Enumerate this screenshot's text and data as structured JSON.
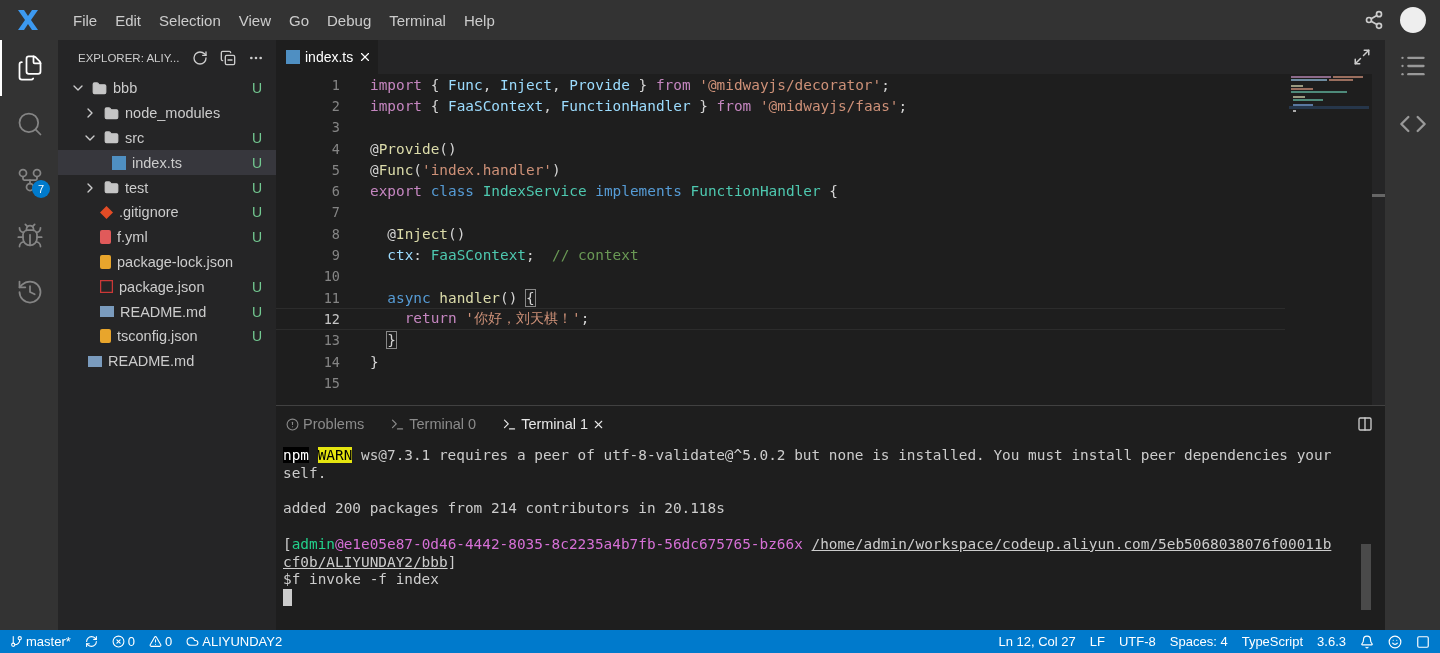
{
  "menu": [
    "File",
    "Edit",
    "Selection",
    "View",
    "Go",
    "Debug",
    "Terminal",
    "Help"
  ],
  "activity_bar": [
    {
      "kind": "files",
      "selected": true
    },
    {
      "kind": "search",
      "selected": false
    },
    {
      "kind": "source-control",
      "selected": false,
      "badge": "7"
    },
    {
      "kind": "debug",
      "selected": false
    },
    {
      "kind": "history",
      "selected": false
    }
  ],
  "explorer": {
    "title": "EXPLORER: ALIY...",
    "tree": [
      {
        "label": "bbb",
        "kind": "folder",
        "expanded": true,
        "selected": false,
        "badge": "U",
        "children": [
          {
            "label": "node_modules",
            "kind": "folder",
            "expanded": false,
            "selected": false
          },
          {
            "label": "src",
            "kind": "folder",
            "expanded": true,
            "selected": false,
            "badge": "U",
            "children": [
              {
                "label": "index.ts",
                "kind": "ts",
                "selected": true,
                "badge": "U"
              }
            ]
          },
          {
            "label": "test",
            "kind": "folder",
            "expanded": false,
            "selected": false,
            "badge": "U"
          },
          {
            "label": ".gitignore",
            "kind": "git",
            "selected": false,
            "badge": "U"
          },
          {
            "label": "f.yml",
            "kind": "yaml",
            "selected": false,
            "badge": "U"
          },
          {
            "label": "package-lock.json",
            "kind": "db",
            "selected": false
          },
          {
            "label": "package.json",
            "kind": "npm",
            "selected": false,
            "badge": "U"
          },
          {
            "label": "README.md",
            "kind": "markdown",
            "selected": false,
            "badge": "U"
          },
          {
            "label": "tsconfig.json",
            "kind": "db",
            "selected": false,
            "badge": "U"
          }
        ]
      },
      {
        "label": "README.md",
        "kind": "markdown",
        "selected": false
      }
    ]
  },
  "editor_tabs": [
    {
      "label": "index.ts",
      "selected": true
    }
  ],
  "code_lines": [
    {
      "number": "1",
      "current": false,
      "tokens": [
        {
          "text": "import",
          "kind": "keyword"
        },
        {
          "text": " { ",
          "kind": "plain"
        },
        {
          "text": "Func",
          "kind": "variable"
        },
        {
          "text": ", ",
          "kind": "plain"
        },
        {
          "text": "Inject",
          "kind": "variable"
        },
        {
          "text": ", ",
          "kind": "plain"
        },
        {
          "text": "Provide",
          "kind": "variable"
        },
        {
          "text": " } ",
          "kind": "plain"
        },
        {
          "text": "from",
          "kind": "keyword"
        },
        {
          "text": " '@midwayjs/decorator'",
          "kind": "string"
        },
        {
          "text": ";",
          "kind": "plain"
        }
      ]
    },
    {
      "number": "2",
      "current": false,
      "tokens": [
        {
          "text": "import",
          "kind": "keyword"
        },
        {
          "text": " { ",
          "kind": "plain"
        },
        {
          "text": "FaaSContext",
          "kind": "variable"
        },
        {
          "text": ", ",
          "kind": "plain"
        },
        {
          "text": "FunctionHandler",
          "kind": "variable"
        },
        {
          "text": " } ",
          "kind": "plain"
        },
        {
          "text": "from",
          "kind": "keyword"
        },
        {
          "text": " '@midwayjs/faas'",
          "kind": "string"
        },
        {
          "text": ";",
          "kind": "plain"
        }
      ]
    },
    {
      "number": "3",
      "current": false
    },
    {
      "number": "4",
      "current": false,
      "tokens": [
        {
          "text": "@",
          "kind": "plain"
        },
        {
          "text": "Provide",
          "kind": "function"
        },
        {
          "text": "()",
          "kind": "plain"
        }
      ]
    },
    {
      "number": "5",
      "current": false,
      "tokens": [
        {
          "text": "@",
          "kind": "plain"
        },
        {
          "text": "Func",
          "kind": "function"
        },
        {
          "text": "(",
          "kind": "plain"
        },
        {
          "text": "'index.handler'",
          "kind": "string"
        },
        {
          "text": ")",
          "kind": "plain"
        }
      ]
    },
    {
      "number": "6",
      "current": false,
      "tokens": [
        {
          "text": "export",
          "kind": "keyword"
        },
        {
          "text": " class",
          "kind": "storage"
        },
        {
          "text": " IndexService",
          "kind": "type"
        },
        {
          "text": " implements",
          "kind": "storage"
        },
        {
          "text": " FunctionHandler",
          "kind": "type"
        },
        {
          "text": " {",
          "kind": "plain"
        }
      ]
    },
    {
      "number": "7",
      "current": false
    },
    {
      "number": "8",
      "current": false,
      "tokens": [
        {
          "text": "  @",
          "kind": "plain"
        },
        {
          "text": "Inject",
          "kind": "function"
        },
        {
          "text": "()",
          "kind": "plain"
        }
      ]
    },
    {
      "number": "9",
      "current": false,
      "tokens": [
        {
          "text": "  ctx",
          "kind": "variable"
        },
        {
          "text": ": ",
          "kind": "plain"
        },
        {
          "text": "FaaSContext",
          "kind": "type"
        },
        {
          "text": ";  ",
          "kind": "plain"
        },
        {
          "text": "// context",
          "kind": "comment"
        }
      ]
    },
    {
      "number": "10",
      "current": false
    },
    {
      "number": "11",
      "current": false,
      "tokens": [
        {
          "text": "  async",
          "kind": "storage"
        },
        {
          "text": " handler",
          "kind": "function"
        },
        {
          "text": "() ",
          "kind": "plain"
        },
        {
          "text": "{",
          "kind": "bracket"
        }
      ]
    },
    {
      "number": "12",
      "current": true,
      "tokens": [
        {
          "text": "    return",
          "kind": "keyword"
        },
        {
          "text": " '你好，刘天棋！'",
          "kind": "string"
        },
        {
          "text": ";",
          "kind": "plain"
        }
      ]
    },
    {
      "number": "13",
      "current": false,
      "tokens": [
        {
          "text": "  }",
          "kind": "bracket"
        }
      ]
    },
    {
      "number": "14",
      "current": false,
      "tokens": [
        {
          "text": "}",
          "kind": "plain"
        }
      ]
    },
    {
      "number": "15",
      "current": false
    }
  ],
  "panel_tabs": [
    {
      "label": "Problems",
      "kind": "problems",
      "selected": false
    },
    {
      "label": "Terminal 0",
      "kind": "terminal",
      "selected": false
    },
    {
      "label": "Terminal 1",
      "kind": "terminal",
      "selected": true
    }
  ],
  "terminal_lines": [
    {
      "space_before": false,
      "tokens": [
        {
          "text": "npm",
          "kind": "inverse"
        },
        {
          "text": "WARN",
          "kind": "warn"
        },
        {
          "text": " ws@7.3.1 requires a peer of utf-8-validate@^5.0.2 but none is installed. You must install peer dependencies your",
          "kind": "plain"
        }
      ]
    },
    {
      "space_before": false,
      "tokens": [
        {
          "text": "self.",
          "kind": "plain"
        }
      ]
    },
    {
      "space_before": true,
      "tokens": [
        {
          "text": "added 200 packages from 214 contributors in 20.118s",
          "kind": "plain"
        }
      ]
    },
    {
      "space_before": true,
      "tokens": [
        {
          "text": "[",
          "kind": "plain"
        },
        {
          "text": "admin",
          "kind": "user"
        },
        {
          "text": "@e1e05e87-0d46-4442-8035-8c2235a4b7fb-56dc675765-bz66x ",
          "kind": "host"
        },
        {
          "text": "/home/admin/workspace/codeup.aliyun.com/5eb5068038076f00011b",
          "kind": "path"
        }
      ]
    },
    {
      "space_before": false,
      "tokens": [
        {
          "text": "cf0b/ALIYUNDAY2/bbb",
          "kind": "path"
        },
        {
          "text": "]",
          "kind": "plain"
        }
      ]
    },
    {
      "space_before": false,
      "tokens": [
        {
          "text": "$f invoke -f index",
          "kind": "plain"
        }
      ]
    },
    {
      "space_before": false,
      "cursor": true
    }
  ],
  "status_bar": {
    "left": [
      {
        "kind": "branch",
        "text": "master*"
      },
      {
        "kind": "sync"
      },
      {
        "kind": "errors",
        "text": "0"
      },
      {
        "kind": "warnings",
        "text": "0"
      },
      {
        "kind": "remote",
        "text": "ALIYUNDAY2"
      }
    ],
    "right": [
      {
        "kind": "text",
        "text": "Ln 12, Col 27"
      },
      {
        "kind": "text",
        "text": "LF"
      },
      {
        "kind": "text",
        "text": "UTF-8"
      },
      {
        "kind": "text",
        "text": "Spaces: 4"
      },
      {
        "kind": "text",
        "text": "TypeScript"
      },
      {
        "kind": "text",
        "text": "3.6.3"
      },
      {
        "kind": "bell"
      },
      {
        "kind": "smiley"
      },
      {
        "kind": "layout"
      }
    ]
  }
}
